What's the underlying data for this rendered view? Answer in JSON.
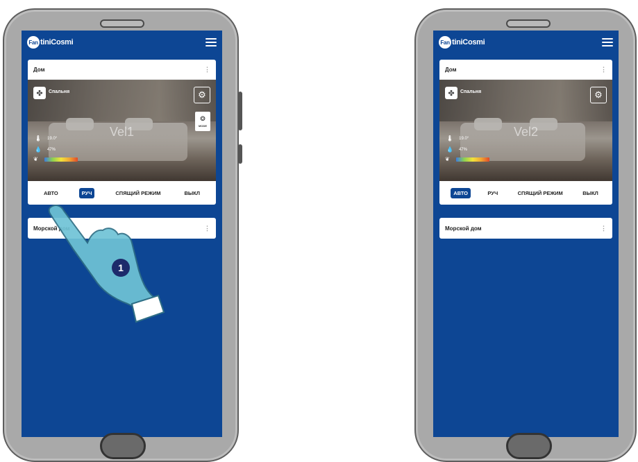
{
  "app": {
    "logo_prefix": "Fan",
    "logo_text": "tiniCosmi"
  },
  "phones": [
    {
      "home_card": {
        "title": "Дом"
      },
      "room": {
        "name": "Спальня",
        "mode_label": "MODE",
        "vel_label": "Vel1",
        "temp": "19.0°",
        "humidity": "47%"
      },
      "tabs": [
        "АВТО",
        "РУЧ",
        "СПЯЩИЙ РЕЖИМ",
        "ВЫКЛ"
      ],
      "active_tab": "РУЧ",
      "second_card": {
        "title": "Морской дом"
      },
      "step_badge": "1"
    },
    {
      "home_card": {
        "title": "Дом"
      },
      "room": {
        "name": "Спальня",
        "vel_label": "Vel2",
        "temp": "19.0°",
        "humidity": "47%"
      },
      "tabs": [
        "АВТО",
        "РУЧ",
        "СПЯЩИЙ РЕЖИМ",
        "ВЫКЛ"
      ],
      "active_tab": "АВТО",
      "second_card": {
        "title": "Морской дом"
      }
    }
  ],
  "icons": {
    "menu": "hamburger-icon",
    "gear": "gear-icon",
    "mode": "fan-mode-icon",
    "room": "fan-icon",
    "kebab": "more-vert-icon",
    "thermometer": "thermometer-icon",
    "drop": "humidity-icon",
    "leaf": "leaf-icon"
  },
  "colors": {
    "brand_blue": "#0d4694",
    "phone_gray": "#a9a9a9",
    "hand_fill": "#6fc3d6"
  }
}
